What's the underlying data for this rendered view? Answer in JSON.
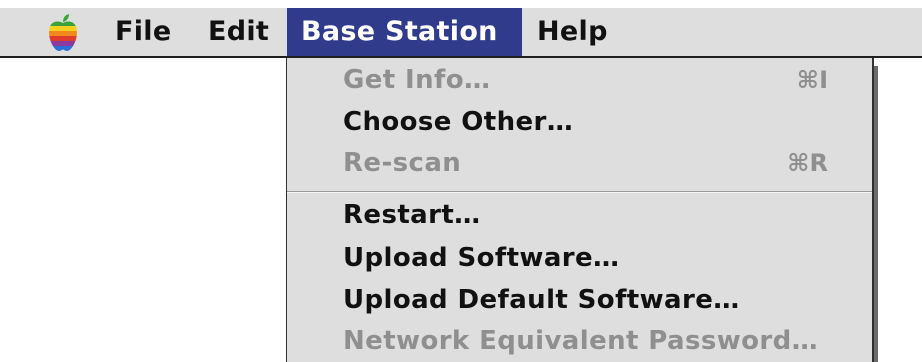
{
  "menubar": {
    "apple_icon": "apple-icon",
    "menus": [
      {
        "label": "File"
      },
      {
        "label": "Edit"
      },
      {
        "label": "Base Station"
      },
      {
        "label": "Help"
      }
    ],
    "active_menu": "Base Station",
    "highlight_color": "#313b8c"
  },
  "dropdown": {
    "items": [
      {
        "label": "Get Info…",
        "shortcut": "⌘I",
        "enabled": false
      },
      {
        "label": "Choose Other…",
        "shortcut": "",
        "enabled": true
      },
      {
        "label": "Re-scan",
        "shortcut": "⌘R",
        "enabled": false
      },
      {
        "label": "Restart…",
        "shortcut": "",
        "enabled": true
      },
      {
        "label": "Upload Software…",
        "shortcut": "",
        "enabled": true
      },
      {
        "label": "Upload Default Software…",
        "shortcut": "",
        "enabled": true
      },
      {
        "label": "Network Equivalent Password…",
        "shortcut": "",
        "enabled": false
      }
    ]
  }
}
